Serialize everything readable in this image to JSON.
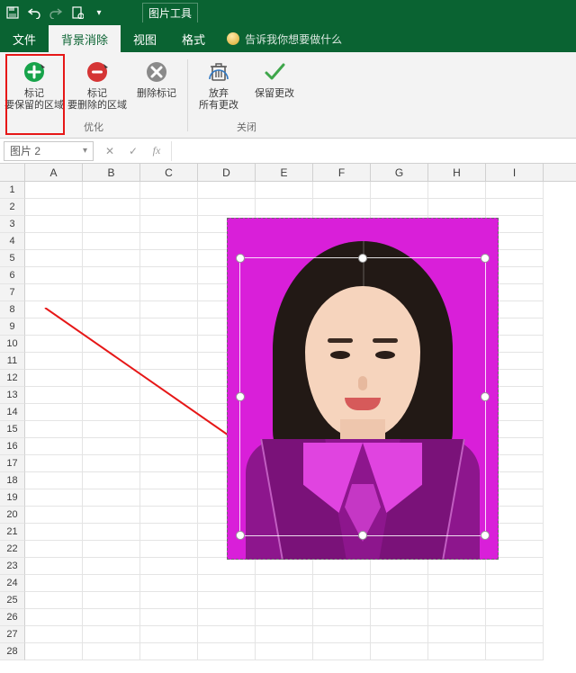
{
  "titlebar": {
    "tool_tab": "图片工具"
  },
  "tabs": {
    "file": "文件",
    "bgremove": "背景消除",
    "view": "视图",
    "format": "格式"
  },
  "tellme": {
    "placeholder": "告诉我你想要做什么"
  },
  "ribbon": {
    "mark_keep_l1": "标记",
    "mark_keep_l2": "要保留的区域",
    "mark_remove_l1": "标记",
    "mark_remove_l2": "要删除的区域",
    "delete_mark": "删除标记",
    "group_optimize": "优化",
    "discard_l1": "放弃",
    "discard_l2": "所有更改",
    "keep_changes": "保留更改",
    "group_close": "关闭"
  },
  "namebox": {
    "value": "图片 2"
  },
  "formula_bar": {
    "cancel": "✕",
    "accept": "✓",
    "fx": "fx"
  },
  "columns": [
    "A",
    "B",
    "C",
    "D",
    "E",
    "F",
    "G",
    "H",
    "I"
  ],
  "row_count": 28
}
